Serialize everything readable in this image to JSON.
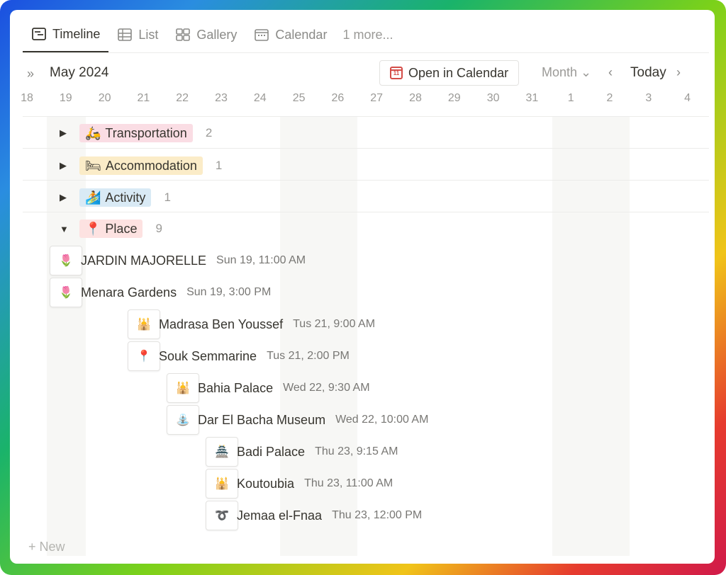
{
  "tabs": [
    {
      "label": "Timeline",
      "icon": "timeline-icon",
      "active": true
    },
    {
      "label": "List",
      "icon": "table-icon"
    },
    {
      "label": "Gallery",
      "icon": "gallery-icon"
    },
    {
      "label": "Calendar",
      "icon": "calendar-icon"
    }
  ],
  "more_tabs": "1 more...",
  "toolbar": {
    "month_title": "May 2024",
    "open_calendar_label": "Open in Calendar",
    "scale_label": "Month",
    "today_label": "Today"
  },
  "days": [
    "18",
    "19",
    "20",
    "21",
    "22",
    "23",
    "24",
    "25",
    "26",
    "27",
    "28",
    "29",
    "30",
    "31",
    "1",
    "2",
    "3",
    "4"
  ],
  "groups": [
    {
      "label": "Transportation",
      "count": "2",
      "emoji": "🛵",
      "color": "#fadde4",
      "expanded": false
    },
    {
      "label": "Accommodation",
      "count": "1",
      "emoji": "🛏",
      "color": "#fbecc8",
      "expanded": false
    },
    {
      "label": "Activity",
      "count": "1",
      "emoji": "🏄",
      "color": "#d9eaf5",
      "expanded": false
    },
    {
      "label": "Place",
      "count": "9",
      "emoji": "📍",
      "color": "#fde2e1",
      "expanded": true
    }
  ],
  "items": [
    {
      "title": "JARDIN MAJORELLE",
      "date": "Sun 19, 11:00 AM",
      "emoji": "🌷"
    },
    {
      "title": "Menara Gardens",
      "date": "Sun 19, 3:00 PM",
      "emoji": "🌷"
    },
    {
      "title": "Madrasa Ben Youssef",
      "date": "Tus 21, 9:00 AM",
      "emoji": "🕌"
    },
    {
      "title": "Souk Semmarine",
      "date": "Tus 21, 2:00 PM",
      "emoji": "📍"
    },
    {
      "title": "Bahia Palace",
      "date": "Wed 22, 9:30 AM",
      "emoji": "🕌"
    },
    {
      "title": "Dar El Bacha Museum",
      "date": "Wed 22, 10:00 AM",
      "emoji": "⛲"
    },
    {
      "title": "Badi Palace",
      "date": "Thu 23, 9:15 AM",
      "emoji": "🏯"
    },
    {
      "title": "Koutoubia",
      "date": "Thu 23, 11:00 AM",
      "emoji": "🕌"
    },
    {
      "title": "Jemaa el-Fnaa",
      "date": "Thu 23, 12:00 PM",
      "emoji": "➰"
    }
  ],
  "new_label": "+ New"
}
